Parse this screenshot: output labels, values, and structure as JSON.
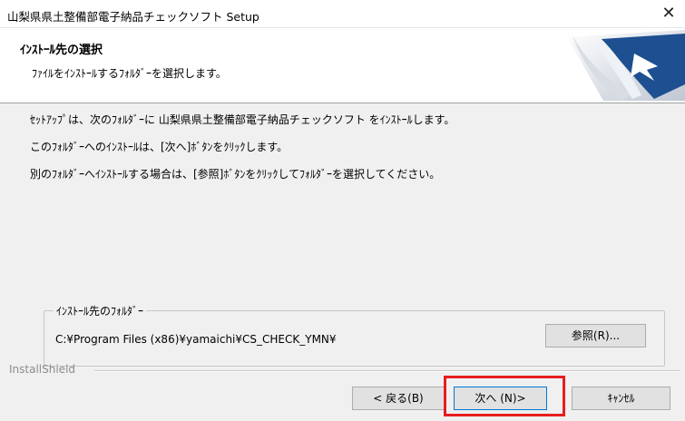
{
  "window": {
    "title": "山梨県県土整備部電子納品チェックソフト Setup",
    "close_glyph": "✕"
  },
  "banner": {
    "heading": "ｲﾝｽﾄｰﾙ先の選択",
    "subheading": "ﾌｧｲﾙをｲﾝｽﾄｰﾙするﾌｫﾙﾀﾞｰを選択します。"
  },
  "body": {
    "line1": "ｾｯﾄｱｯﾌﾟは、次のﾌｫﾙﾀﾞｰに 山梨県県土整備部電子納品チェックソフト をｲﾝｽﾄｰﾙします。",
    "line2": "このﾌｫﾙﾀﾞｰへのｲﾝｽﾄｰﾙは、[次へ]ﾎﾞﾀﾝをｸﾘｯｸします。",
    "line3": "別のﾌｫﾙﾀﾞｰへｲﾝｽﾄｰﾙする場合は、[参照]ﾎﾞﾀﾝをｸﾘｯｸしてﾌｫﾙﾀﾞｰを選択してください。"
  },
  "destination": {
    "legend": "ｲﾝｽﾄｰﾙ先のﾌｫﾙﾀﾞｰ",
    "path": "C:¥Program Files (x86)¥yamaichi¥CS_CHECK_YMN¥",
    "browse_label": "参照(R)..."
  },
  "footer": {
    "installshield_label": "InstallShield",
    "back_label": "< 戻る(B)",
    "next_label": "次へ (N)>",
    "cancel_label": "ｷｬﾝｾﾙ"
  },
  "colors": {
    "highlight": "#e81d1d",
    "logo_blue": "#1d4f91"
  }
}
